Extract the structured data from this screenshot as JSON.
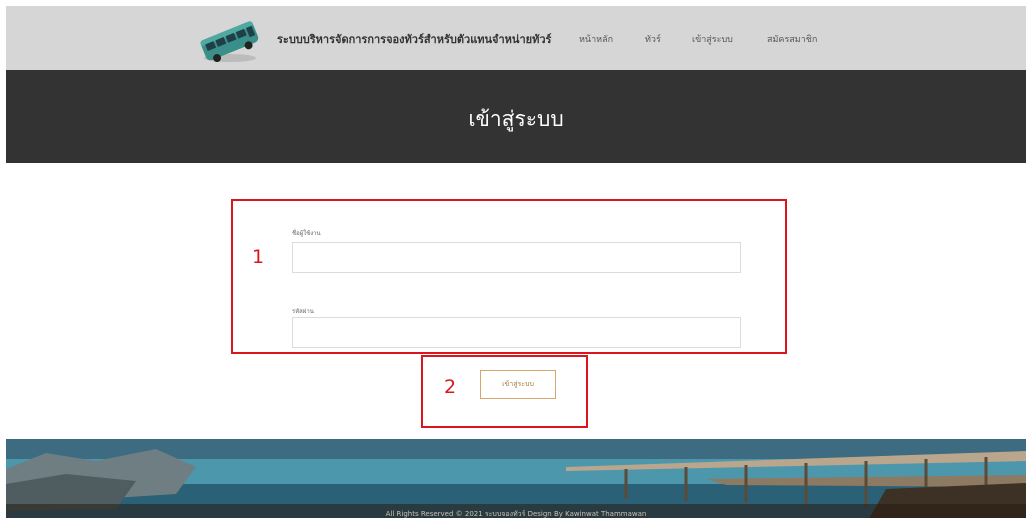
{
  "header": {
    "brand_text": "ระบบบริหารจัดการการจองทัวร์สำหรับตัวแทนจำหน่ายทัวร์",
    "nav": {
      "home": "หน้าหลัก",
      "tour": "ทัวร์",
      "login": "เข้าสู่ระบบ",
      "register": "สมัครสมาชิก"
    }
  },
  "banner": {
    "title": "เข้าสู่ระบบ"
  },
  "form": {
    "username_label": "ชื่อผู้ใช้งาน",
    "username_value": "",
    "password_label": "รหัสผ่าน",
    "password_value": "",
    "submit_label": "เข้าสู่ระบบ"
  },
  "annotations": {
    "box1_number": "1",
    "box2_number": "2"
  },
  "footer": {
    "copyright": "All Rights Reserved  © 2021 ระบบจองทัวร์ Design By   Kawinwat Thammawan"
  },
  "colors": {
    "header_bg": "#d6d6d6",
    "banner_bg": "#333333",
    "annotation_red": "#d9161d",
    "button_border": "#d6a66a",
    "bus_teal": "#3a8f8a"
  },
  "icons": {
    "logo": "bus-icon"
  }
}
